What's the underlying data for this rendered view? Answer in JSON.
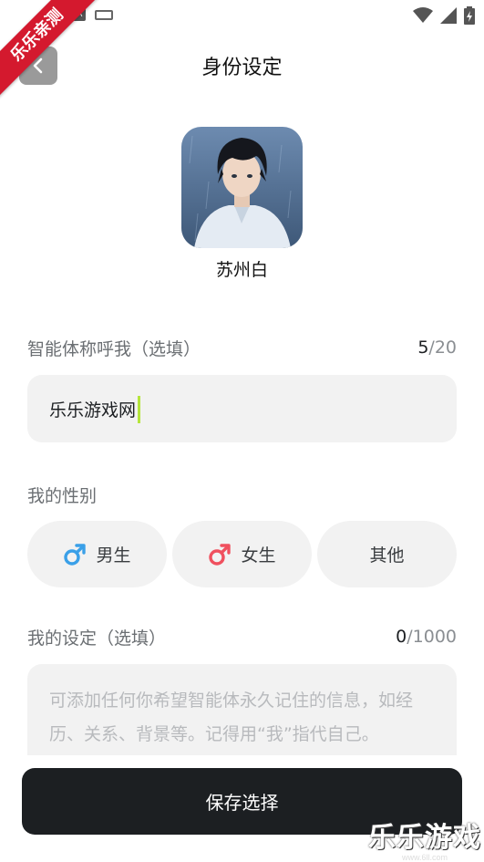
{
  "ribbon": {
    "text": "乐乐亲测"
  },
  "status_bar": {
    "icon_a_letter": "A"
  },
  "header": {
    "title": "身份设定"
  },
  "character": {
    "name": "苏州白"
  },
  "nickname": {
    "label": "智能体称呼我（选填）",
    "count_current": "5",
    "count_max": "/20",
    "value": "乐乐游戏网"
  },
  "gender": {
    "label": "我的性别",
    "options": [
      {
        "label": "男生",
        "icon": "male-icon"
      },
      {
        "label": "女生",
        "icon": "female-icon"
      },
      {
        "label": "其他"
      }
    ]
  },
  "settings": {
    "label": "我的设定（选填）",
    "count_current": "0",
    "count_max": "/1000",
    "placeholder": "可添加任何你希望智能体永久记住的信息，如经历、关系、背景等。记得用“我”指代自己。"
  },
  "footer": {
    "save_label": "保存选择"
  },
  "watermark": {
    "text": "乐乐游戏",
    "url": "www.6ll.com"
  },
  "colors": {
    "primary_dark": "#1c1f22",
    "field_bg": "#f2f2f2",
    "caret": "#b5e53c",
    "ribbon": "#d4192e",
    "male": "#3aa0e8",
    "female": "#f0505e"
  }
}
